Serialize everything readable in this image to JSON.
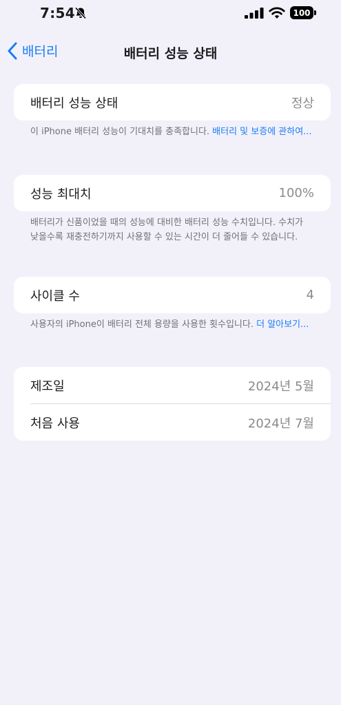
{
  "status_bar": {
    "time": "7:54",
    "battery_level": "100",
    "icons": [
      "bell-slash-icon",
      "cellular-signal-icon",
      "wifi-icon",
      "battery-icon"
    ]
  },
  "nav": {
    "back_label": "배터리",
    "title": "배터리 성능 상태"
  },
  "health_card": {
    "label": "배터리 성능 상태",
    "value": "정상"
  },
  "health_footnote": {
    "text": "이 iPhone 배터리 성능이 기대치를 충족합니다. ",
    "link": "배터리 및 보증에 관하여..."
  },
  "capacity_card": {
    "label": "성능 최대치",
    "value": "100%"
  },
  "capacity_footnote": {
    "text": "배터리가 신품이었을 때의 성능에 대비한 배터리 성능 수치입니다. 수치가 낮을수록 재충전하기까지 사용할 수 있는 시간이 더 줄어들 수 있습니다."
  },
  "cycle_card": {
    "label": "사이클 수",
    "value": "4"
  },
  "cycle_footnote": {
    "text": "사용자의 iPhone이 배터리 전체 용량을 사용한 횟수입니다. ",
    "link": "더 알아보기..."
  },
  "dates_card": {
    "manufactured_label": "제조일",
    "manufactured_value": "2024년 5월",
    "first_use_label": "처음 사용",
    "first_use_value": "2024년 7월"
  },
  "colors": {
    "background": "#f2f1fa",
    "card": "#ffffff",
    "accent": "#1a7df5",
    "secondary_text": "#8a8a8e"
  }
}
